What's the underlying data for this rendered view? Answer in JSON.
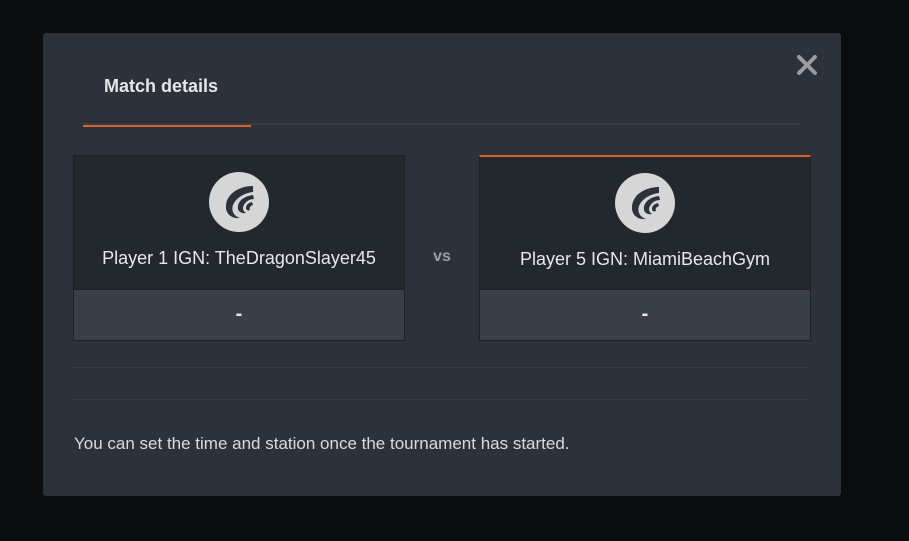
{
  "modal": {
    "tabs": [
      {
        "label": "Match details",
        "active": true
      }
    ],
    "close_icon": "close-icon",
    "player_left": {
      "name": "Player 1 IGN: TheDragonSlayer45",
      "avatar_icon": "wing-logo-icon",
      "score": "-"
    },
    "versus_label": "vs",
    "player_right": {
      "name": "Player 5 IGN: MiamiBeachGym",
      "avatar_icon": "wing-logo-icon",
      "score": "-"
    },
    "footer_note": "You can set the time and station once the tournament has started."
  },
  "colors": {
    "accent": "#d9622b",
    "modal_background": "#2d3139",
    "card_background": "#23272e",
    "score_background": "#3a3e48",
    "page_background": "#0b0c0e"
  }
}
